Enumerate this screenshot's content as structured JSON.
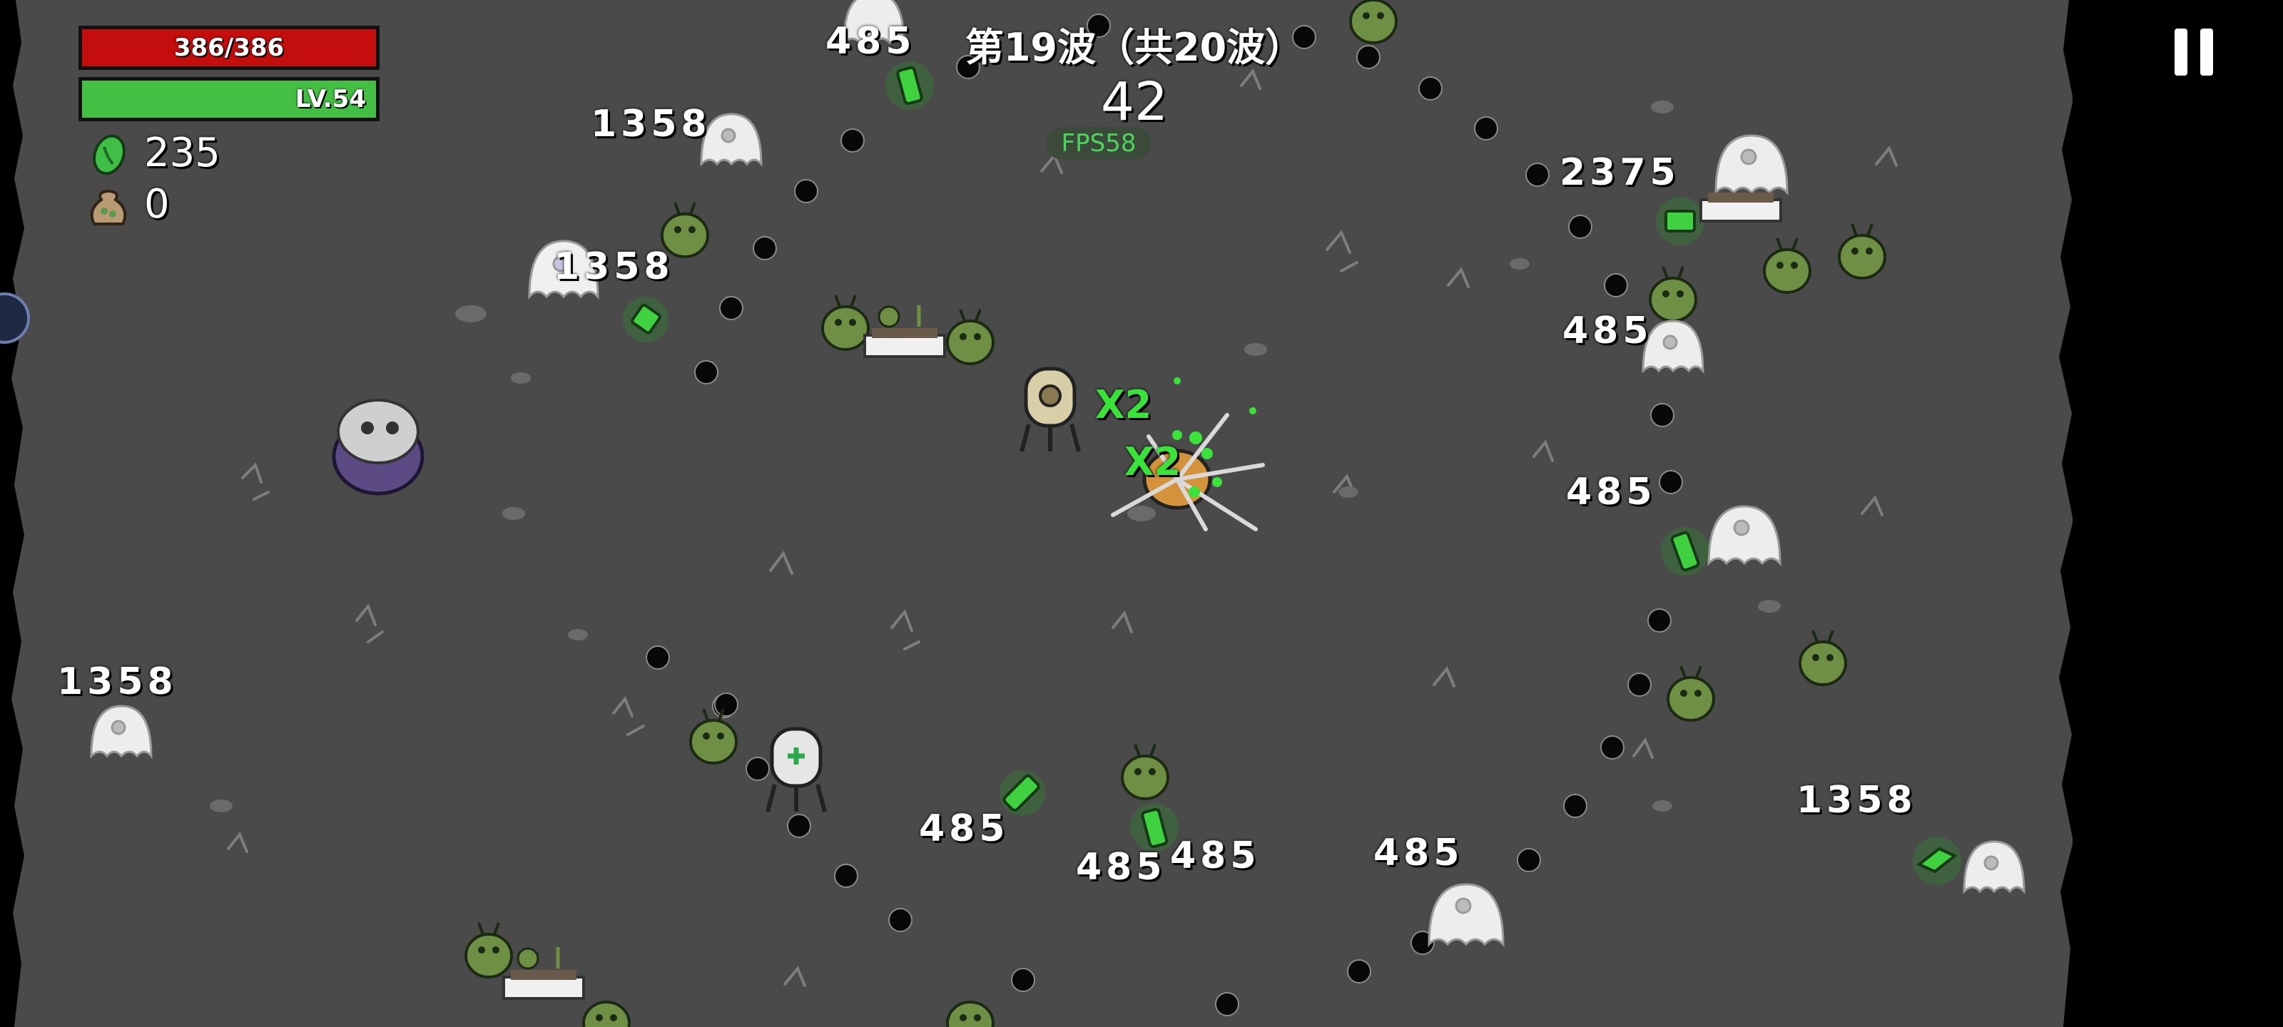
{
  "hud": {
    "hp_text": "386/386",
    "level_text": "LV.54",
    "material_count": "235",
    "bag_count": "0",
    "wave_title": "第19波（共20波）",
    "wave_timer": "42",
    "fps_text": "FPS58"
  },
  "icons": {
    "material": "green-material-icon",
    "bag": "loot-bag-icon",
    "pause": "pause-icon"
  },
  "colors": {
    "hp": "#c40d0d",
    "xp": "#43c043",
    "arena": "#4a4a4a",
    "damage_text": "#ffffff",
    "crit_text": "#39e33a"
  },
  "damage_numbers": [
    "485",
    "1358",
    "1358",
    "2375",
    "485",
    "485",
    "1358",
    "485",
    "485",
    "485",
    "485",
    "1358"
  ],
  "multipliers": [
    "X2",
    "X2"
  ]
}
